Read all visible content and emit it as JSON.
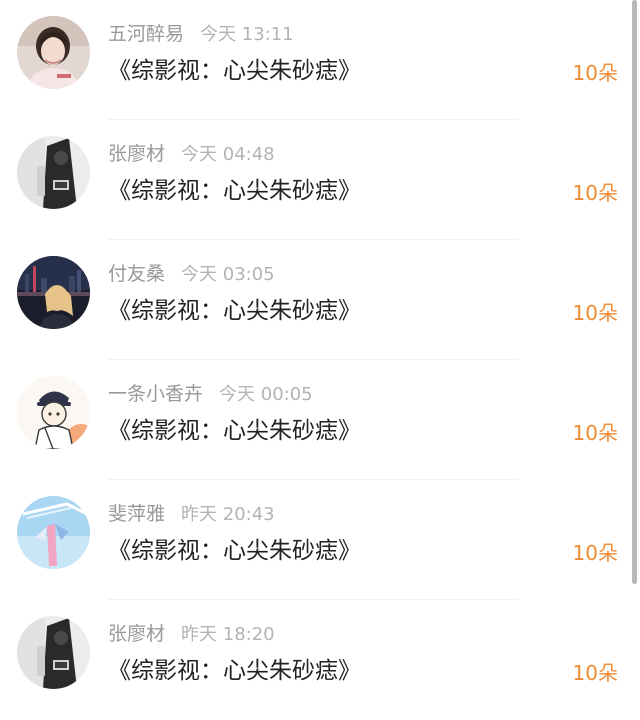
{
  "colors": {
    "count": "#f08a33",
    "username": "#999999",
    "time": "#b4b4b4",
    "title": "#222222",
    "divider": "#f1f1f1",
    "scrollbar": "#b9b9b9"
  },
  "list": [
    {
      "username": "五河醉易",
      "time": "今天 13:11",
      "title": "《综影视：心尖朱砂痣》",
      "count": "10朵",
      "avatar": "avatar-girl-pink-shirt"
    },
    {
      "username": "张廖材",
      "time": "今天 04:48",
      "title": "《综影视：心尖朱砂痣》",
      "count": "10朵",
      "avatar": "avatar-dark-bw-photo"
    },
    {
      "username": "付友桑",
      "time": "今天 03:05",
      "title": "《综影视：心尖朱砂痣》",
      "count": "10朵",
      "avatar": "avatar-night-city"
    },
    {
      "username": "一条小香卉",
      "time": "今天 00:05",
      "title": "《综影视：心尖朱砂痣》",
      "count": "10朵",
      "avatar": "avatar-cartoon-girl"
    },
    {
      "username": "斐萍雅",
      "time": "昨天 20:43",
      "title": "《综影视：心尖朱砂痣》",
      "count": "10朵",
      "avatar": "avatar-sky-photo"
    },
    {
      "username": "张廖材",
      "time": "昨天 18:20",
      "title": "《综影视：心尖朱砂痣》",
      "count": "10朵",
      "avatar": "avatar-dark-bw-photo"
    }
  ]
}
